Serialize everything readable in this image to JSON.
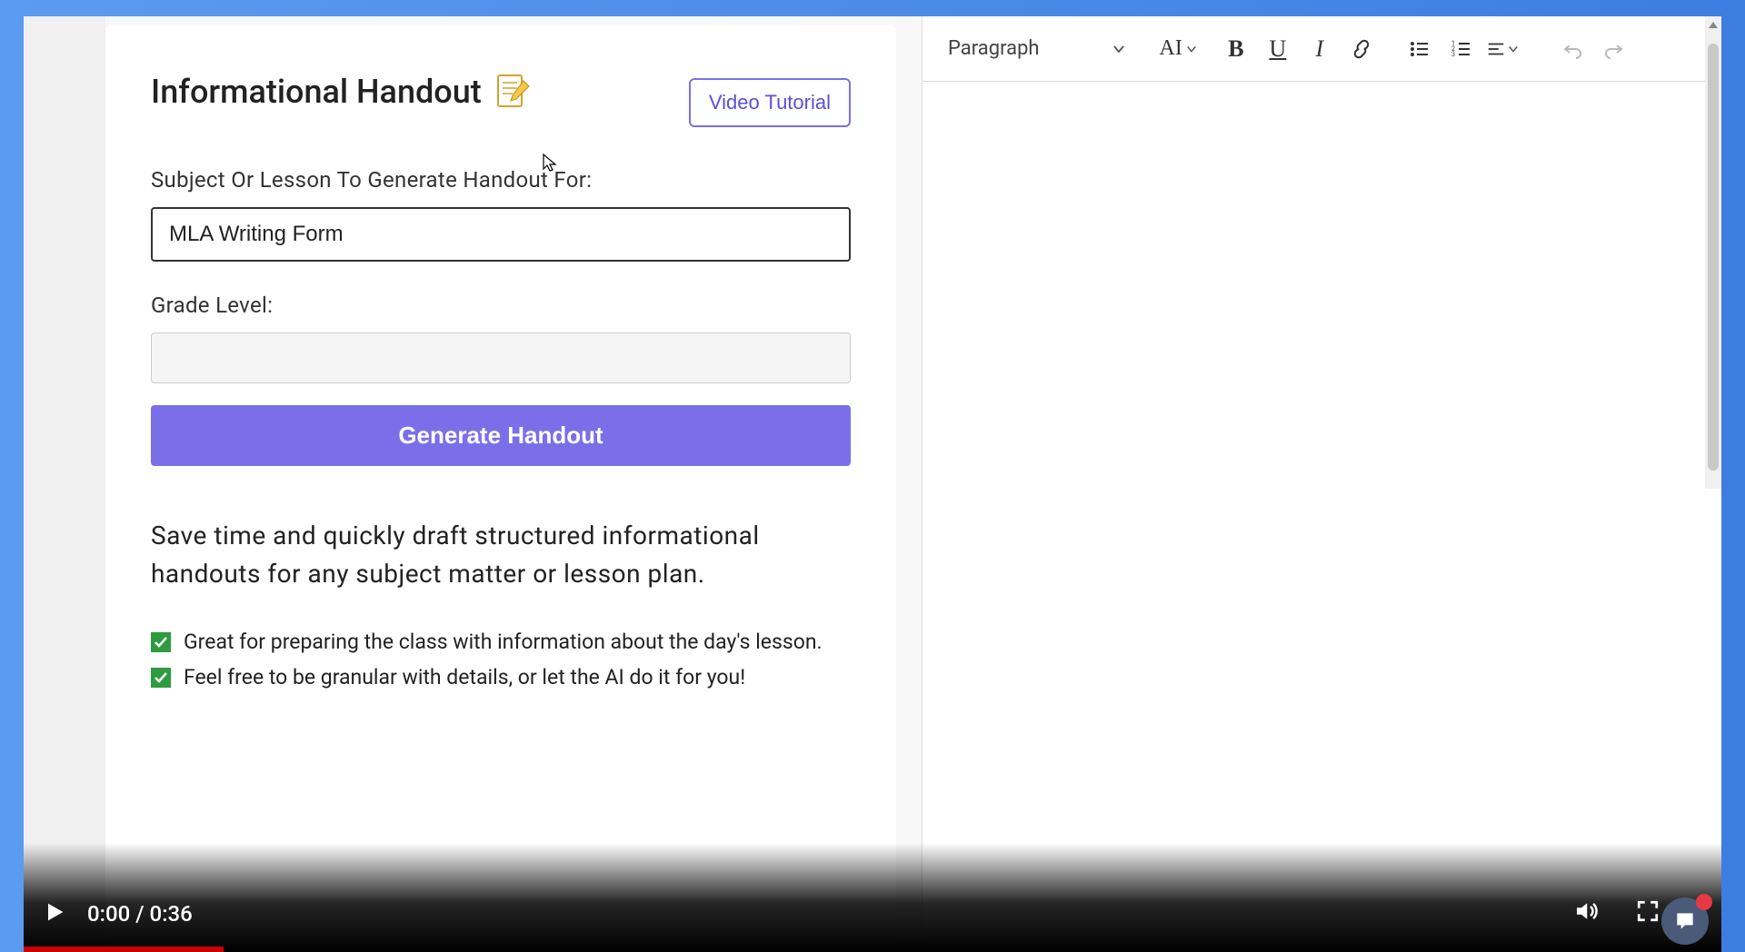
{
  "form": {
    "title": "Informational Handout",
    "video_tutorial_label": "Video Tutorial",
    "subject_label": "Subject Or Lesson To Generate Handout For:",
    "subject_value": "MLA Writing Form",
    "grade_label": "Grade Level:",
    "grade_value": "",
    "generate_label": "Generate Handout",
    "description": "Save time and quickly draft structured informational handouts for any subject matter or lesson plan.",
    "benefits": [
      "Great for preparing the class with information about the day's lesson.",
      "Feel free to be granular with details, or let the AI do it for you!"
    ]
  },
  "editor": {
    "style_selector": "Paragraph",
    "font_size_label": "AI"
  },
  "video": {
    "current_time": "0:00",
    "duration": "0:36"
  }
}
